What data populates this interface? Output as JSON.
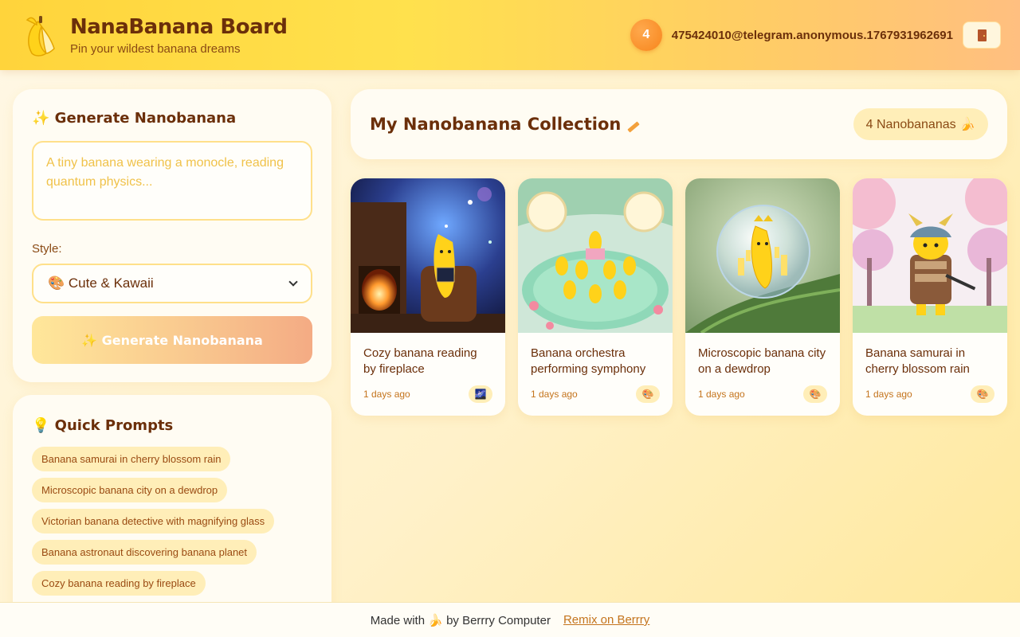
{
  "header": {
    "title": "NanaBanana Board",
    "subtitle": "Pin your wildest banana dreams",
    "count": "4",
    "user_email": "475424010@telegram.anonymous.1767931962691",
    "logout_icon": "door-icon"
  },
  "generate": {
    "title": "✨ Generate Nanobanana",
    "prompt_placeholder": "A tiny banana wearing a monocle, reading quantum physics...",
    "style_label": "Style:",
    "style_selected": "🎨 Cute & Kawaii",
    "button_label": "✨ Generate Nanobanana"
  },
  "quick_prompts": {
    "title": "💡 Quick Prompts",
    "items": [
      "Banana samurai in cherry blossom rain",
      "Microscopic banana city on a dewdrop",
      "Victorian banana detective with magnifying glass",
      "Banana astronaut discovering banana planet",
      "Cozy banana reading by fireplace"
    ]
  },
  "collection": {
    "title": "My Nanobanana Collection",
    "count_label": "4 Nanobananas 🍌",
    "cards": [
      {
        "title": "Cozy banana reading by fireplace",
        "date": "1 days ago",
        "badge": "🌌"
      },
      {
        "title": "Banana orchestra performing symphony",
        "date": "1 days ago",
        "badge": "🎨"
      },
      {
        "title": "Microscopic banana city on a dewdrop",
        "date": "1 days ago",
        "badge": "🎨"
      },
      {
        "title": "Banana samurai in cherry blossom rain",
        "date": "1 days ago",
        "badge": "🎨"
      }
    ]
  },
  "footer": {
    "made_with": "Made with 🍌 by Berrry Computer",
    "remix_link": "Remix on Berrry"
  },
  "colors": {
    "header_gradient_start": "#ffd43b",
    "accent_orange": "#f7851c",
    "text_brown": "#6b2f0a",
    "chip_bg": "#ffeeb8"
  }
}
